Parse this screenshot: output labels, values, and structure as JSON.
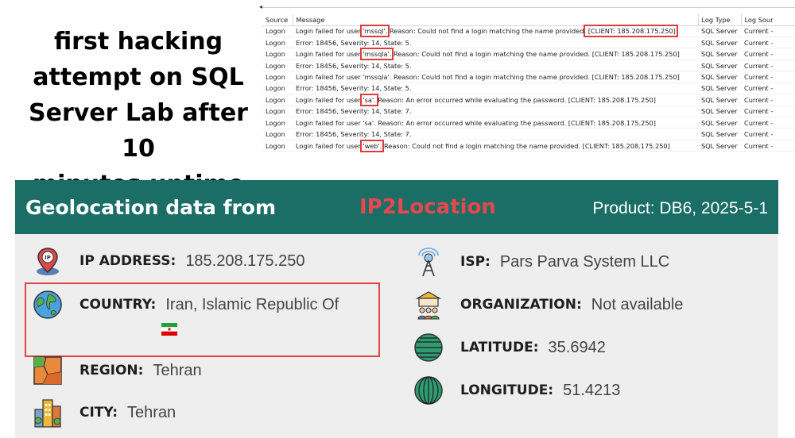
{
  "headline": {
    "lines": [
      "first hacking",
      "attempt on SQL",
      "Server Lab after 10",
      "minutes uptime"
    ]
  },
  "log": {
    "columns": [
      "Source",
      "Message",
      "Log Type",
      "Log Sour"
    ],
    "rows": [
      {
        "source": "Logon",
        "pre": "Login failed for user ",
        "hl": "'mssql'.",
        "post": " Reason: Could not find a login matching the name provided.",
        "client": " [CLIENT: 185.208.175.250]",
        "client_hl": true,
        "type": "SQL Server",
        "logsrc": "Current -"
      },
      {
        "source": "Logon",
        "pre": "Error: 18456, Severity: 14, State: 5.",
        "hl": "",
        "post": "",
        "client": "",
        "client_hl": false,
        "type": "SQL Server",
        "logsrc": "Current -"
      },
      {
        "source": "Logon",
        "pre": "Login failed for user ",
        "hl": "'mssqla'.",
        "post": " Reason: Could not find a login matching the name provided.",
        "client": " [CLIENT: 185.208.175.250]",
        "client_hl": false,
        "type": "SQL Server",
        "logsrc": "Current -"
      },
      {
        "source": "Logon",
        "pre": "Error: 18456, Severity: 14, State: 5.",
        "hl": "",
        "post": "",
        "client": "",
        "client_hl": false,
        "type": "SQL Server",
        "logsrc": "Current -"
      },
      {
        "source": "Logon",
        "pre": "Login failed for user 'mssqla'. Reason: Could not find a login matching the name provided. [CLIENT: 185.208.175.250]",
        "hl": "",
        "post": "",
        "client": "",
        "client_hl": false,
        "type": "SQL Server",
        "logsrc": "Current -"
      },
      {
        "source": "Logon",
        "pre": "Error: 18456, Severity: 14, State: 5.",
        "hl": "",
        "post": "",
        "client": "",
        "client_hl": false,
        "type": "SQL Server",
        "logsrc": "Current -"
      },
      {
        "source": "Logon",
        "pre": "Login failed for user ",
        "hl": "'sa'.",
        "post": " Reason: An error occurred while evaluating the password. [CLIENT: 185.208.175.250]",
        "client": "",
        "client_hl": false,
        "type": "SQL Server",
        "logsrc": "Current -"
      },
      {
        "source": "Logon",
        "pre": "Error: 18456, Severity: 14, State: 7.",
        "hl": "",
        "post": "",
        "client": "",
        "client_hl": false,
        "type": "SQL Server",
        "logsrc": "Current -"
      },
      {
        "source": "Logon",
        "pre": "Login failed for user 'sa'. Reason: An error occurred while evaluating the password. [CLIENT: 185.208.175.250]",
        "hl": "",
        "post": "",
        "client": "",
        "client_hl": false,
        "type": "SQL Server",
        "logsrc": "Current -"
      },
      {
        "source": "Logon",
        "pre": "Error: 18456, Severity: 14, State: 7.",
        "hl": "",
        "post": "",
        "client": "",
        "client_hl": false,
        "type": "SQL Server",
        "logsrc": "Current -"
      },
      {
        "source": "Logon",
        "pre": "Login failed for user ",
        "hl": "'web'.",
        "post": " Reason: Could not find a login matching the name provided. [CLIENT: 185.208.175.250]",
        "client": "",
        "client_hl": false,
        "type": "SQL Server",
        "logsrc": "Current -"
      },
      {
        "source": "",
        "pre": "",
        "hl": "",
        "post": "",
        "client": "",
        "client_hl": false,
        "type": "",
        "logsrc": ""
      }
    ]
  },
  "geo": {
    "title": "Geolocation data from",
    "brand": "IP2Location",
    "product": "Product: DB6, 2025-5-1",
    "ip": {
      "label": "IP ADDRESS:",
      "value": "185.208.175.250",
      "icon": "ip-pin-icon"
    },
    "country": {
      "label": "COUNTRY:",
      "value": "Iran, Islamic Republic Of",
      "icon": "globe-icon",
      "flag": "iran-flag-icon"
    },
    "region": {
      "label": "REGION:",
      "value": "Tehran",
      "icon": "region-map-icon"
    },
    "city": {
      "label": "CITY:",
      "value": "Tehran",
      "icon": "city-buildings-icon"
    },
    "isp": {
      "label": "ISP:",
      "value": "Pars Parva System LLC",
      "icon": "antenna-tower-icon"
    },
    "organization": {
      "label": "ORGANIZATION:",
      "value": "Not available",
      "icon": "organization-people-icon"
    },
    "latitude": {
      "label": "LATITUDE:",
      "value": "35.6942",
      "icon": "latitude-globe-icon"
    },
    "longitude": {
      "label": "LONGITUDE:",
      "value": "51.4213",
      "icon": "longitude-globe-icon"
    }
  },
  "colors": {
    "header": "#1a6e66",
    "brand": "#e5484d",
    "highlight": "#e03a3a",
    "card": "#eeeeee"
  }
}
